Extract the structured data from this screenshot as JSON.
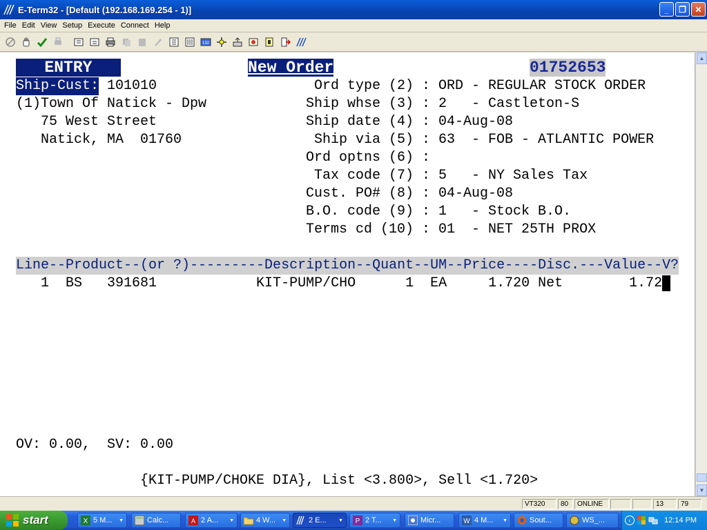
{
  "window": {
    "title": "E-Term32 - [Default (192.168.169.254 - 1)]",
    "buttons": {
      "minimize": "_",
      "restore": "❐",
      "close": "✕"
    }
  },
  "menu": [
    "File",
    "Edit",
    "View",
    "Setup",
    "Execute",
    "Connect",
    "Help"
  ],
  "terminal": {
    "header_entry": "   ENTRY   ",
    "header_new_order": "New Order",
    "order_number": "01752653",
    "ship_cust_label": "Ship-Cust:",
    "ship_cust_value": "101010",
    "address_lines": [
      "(1)Town Of Natick - Dpw",
      "   75 West Street",
      "   Natick, MA  01760"
    ],
    "fields": [
      " Ord type (2) : ORD - REGULAR STOCK ORDER",
      "Ship whse (3) : 2   - Castleton-S",
      "Ship date (4) : 04-Aug-08",
      " Ship via (5) : 63  - FOB - ATLANTIC POWER",
      "Ord optns (6) :",
      " Tax code (7) : 5   - NY Sales Tax",
      "Cust. PO# (8) : 04-Aug-08",
      "B.O. code (9) : 1   - Stock B.O.",
      "Terms cd (10) : 01  - NET 25TH PROX"
    ],
    "grid_header": "Line--Product--(or ?)---------Description--Quant--UM--Price----Disc.---Value--V?",
    "grid_rows": [
      "   1  BS   391681            KIT-PUMP/CHO      1  EA     1.720 Net        1.72 "
    ],
    "cursor": "_",
    "totals": "OV: 0.00,  SV: 0.00",
    "info_line": "{KIT-PUMP/CHOKE DIA}, List <3.800>, Sell <1.720>"
  },
  "statusbar": {
    "emulation": "VT320",
    "columns": "80",
    "state": "ONLINE",
    "row": "13",
    "col": "79"
  },
  "taskbar": {
    "start_label": "start",
    "tasks": [
      {
        "label": "5 M...",
        "active": false
      },
      {
        "label": "Calc...",
        "active": false
      },
      {
        "label": "2 A...",
        "active": false
      },
      {
        "label": "4 W...",
        "active": false
      },
      {
        "label": "2 E...",
        "active": true
      },
      {
        "label": "2 T...",
        "active": false
      },
      {
        "label": "Micr...",
        "active": false
      },
      {
        "label": "4 M...",
        "active": false
      },
      {
        "label": "Sout...",
        "active": false
      },
      {
        "label": "WS_...",
        "active": false
      }
    ],
    "clock": "12:14 PM"
  }
}
